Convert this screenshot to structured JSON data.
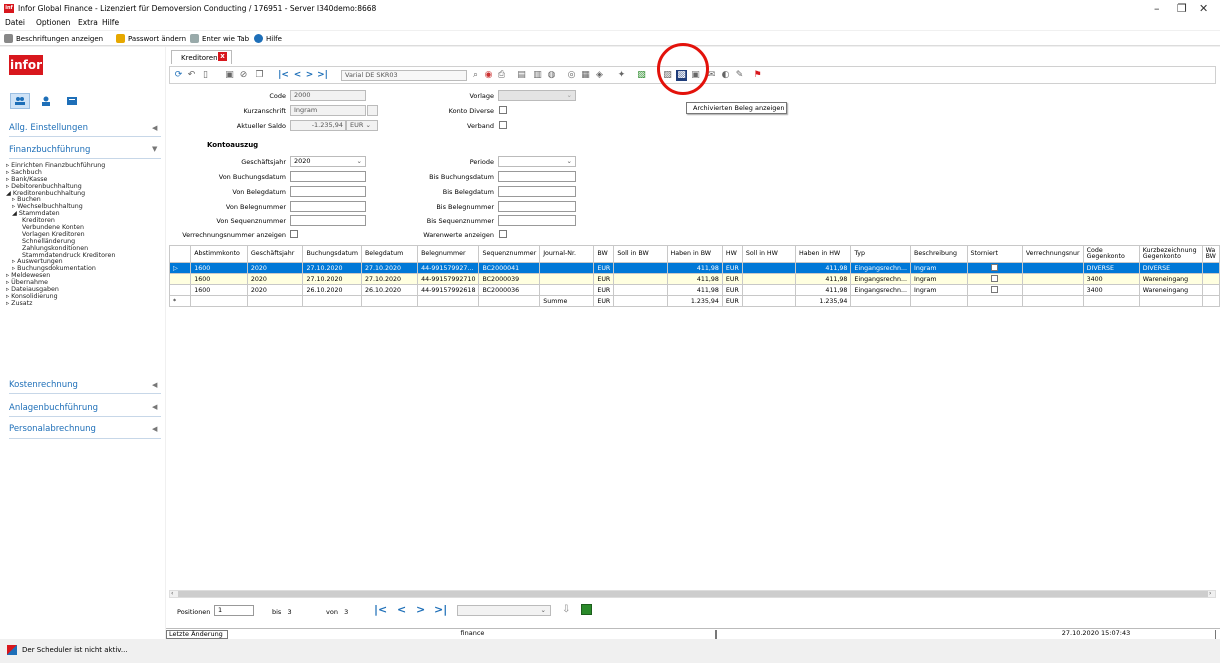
{
  "window": {
    "title": "Infor Global Finance - Lizenziert für Demoversion Conducting / 176951 - Server I340demo:8668",
    "controls": {
      "minimize": "–",
      "maximize": "❐",
      "close": "✕"
    }
  },
  "menu": [
    "Datei",
    "Optionen",
    "Extra",
    "Hilfe"
  ],
  "toolbar": {
    "captions": "Beschriftungen anzeigen",
    "password": "Passwort ändern",
    "enter_tab": "Enter wie Tab",
    "help": "Hilfe"
  },
  "sidebar": {
    "logo": "infor",
    "sections": {
      "allg": "Allg. Einstellungen",
      "finanz": "Finanzbuchführung",
      "kosten": "Kostenrechnung",
      "anlagen": "Anlagenbuchführung",
      "personal": "Personalabrechnung"
    },
    "tree": [
      "▹ Einrichten Finanzbuchführung",
      "▹ Sachbuch",
      "▹ Bank/Kasse",
      "▹ Debitorenbuchhaltung",
      "◢ Kreditorenbuchhaltung",
      "   ▹ Buchen",
      "   ▹ Wechselbuchhaltung",
      "   ◢ Stammdaten",
      "        Kreditoren",
      "        Verbundene Konten",
      "        Vorlagen Kreditoren",
      "        Schnelländerung",
      "        Zahlungskonditionen",
      "        Stammdatendruck Kreditoren",
      "   ▹ Auswertungen",
      "   ▹ Buchungsdokumentation",
      "▹ Meldewesen",
      "▹ Übernahme",
      "▹ Dateiausgaben",
      "▹ Konsolidierung",
      "▹ Zusatz"
    ]
  },
  "tab": {
    "label": "Kreditoren",
    "close": "x"
  },
  "variant": "Varial DE SKR03",
  "tooltip": "Archivierten Beleg anzeigen",
  "form": {
    "code_label": "Code",
    "code": "2000",
    "kurz_label": "Kurzanschrift",
    "kurz": "Ingram",
    "saldo_label": "Aktueller Saldo",
    "saldo": "-1.235,94",
    "currency": "EUR",
    "vorlage_label": "Vorlage",
    "konto_diverse_label": "Konto Diverse",
    "verband_label": "Verband",
    "kontoauszug": "Kontoauszug",
    "gj_label": "Geschäftsjahr",
    "gj": "2020",
    "periode_label": "Periode",
    "von_buchungsdatum": "Von Buchungsdatum",
    "bis_buchungsdatum": "Bis Buchungsdatum",
    "von_belegdatum": "Von Belegdatum",
    "bis_belegdatum": "Bis Belegdatum",
    "von_belegnummer": "Von Belegnummer",
    "bis_belegnummer": "Bis Belegnummer",
    "von_sequenz": "Von Sequenznummer",
    "bis_sequenz": "Bis Sequenznummer",
    "verrechnung_label": "Verrechnungsnummer anzeigen",
    "warenwerte_label": "Warenwerte anzeigen"
  },
  "grid": {
    "headers": [
      "Abstimmkonto",
      "Geschäftsjahr",
      "Buchungsdatum",
      "Belegdatum",
      "Belegnummer",
      "Sequenznummer",
      "Journal-Nr.",
      "BW",
      "Soll in BW",
      "Haben in BW",
      "HW",
      "Soll in HW",
      "Haben in HW",
      "Typ",
      "Beschreibung",
      "Storniert",
      "Verrechnungsnur",
      "Code Gegenkonto",
      "Kurzbezeichnung Gegenkonto",
      "Wa BW"
    ],
    "rows": [
      [
        "1600",
        "2020",
        "27.10.2020",
        "27.10.2020",
        "44-991579927...",
        "BC2000041",
        "",
        "EUR",
        "",
        "411,98",
        "EUR",
        "",
        "411,98",
        "Eingangsrechn...",
        "Ingram",
        "",
        "",
        "DIVERSE",
        "DIVERSE",
        ""
      ],
      [
        "1600",
        "2020",
        "27.10.2020",
        "27.10.2020",
        "44-99157992710",
        "BC2000039",
        "",
        "EUR",
        "",
        "411,98",
        "EUR",
        "",
        "411,98",
        "Eingangsrechn...",
        "Ingram",
        "",
        "",
        "3400",
        "Wareneingang",
        ""
      ],
      [
        "1600",
        "2020",
        "26.10.2020",
        "26.10.2020",
        "44-99157992618",
        "BC2000036",
        "",
        "EUR",
        "",
        "411,98",
        "EUR",
        "",
        "411,98",
        "Eingangsrechn...",
        "Ingram",
        "",
        "",
        "3400",
        "Wareneingang",
        ""
      ]
    ],
    "sum_label": "Summe",
    "sum_currency": "EUR",
    "sum_haben_bw": "1.235,94",
    "sum_hw": "EUR",
    "sum_haben_hw": "1.235,94",
    "new_row_marker": "*",
    "current_row_marker": "▷"
  },
  "pager": {
    "positionen_label": "Positionen",
    "positionen": "1",
    "bis_label": "bis",
    "bis": "3",
    "von_label": "von",
    "von": "3"
  },
  "statusbar": {
    "last_change": "Letzte Änderung",
    "user": "finance",
    "timestamp": "27.10.2020 15:07:43"
  },
  "scheduler": "Der Scheduler ist nicht aktiv...",
  "colors": {
    "brand": "#d8171d",
    "link": "#1e6fb8",
    "selection": "#0078d7",
    "highlight": "#e3120b"
  }
}
